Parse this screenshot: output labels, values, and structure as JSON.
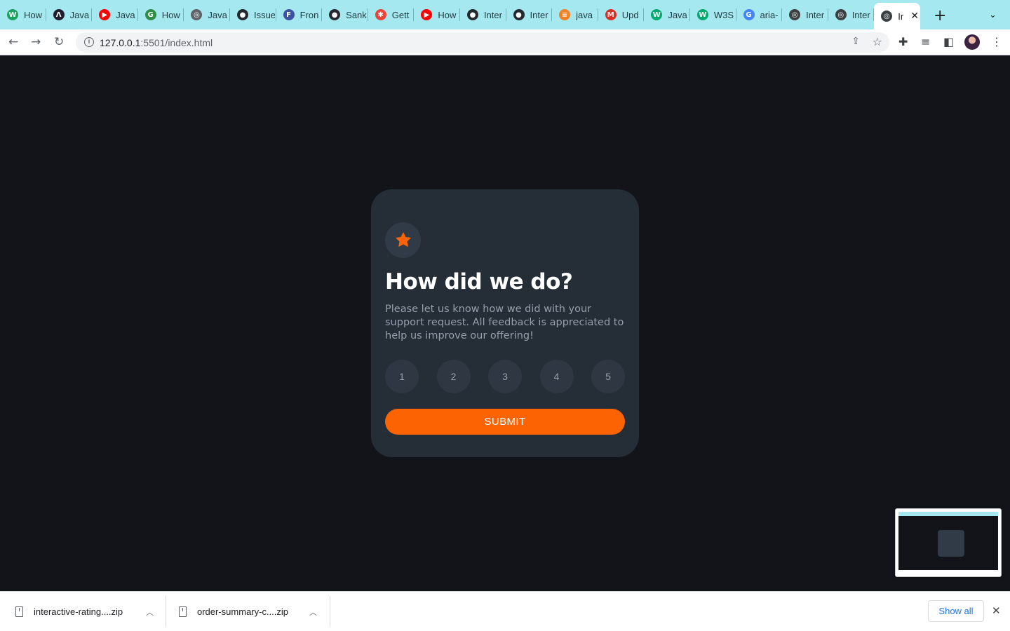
{
  "tabs": [
    {
      "title": "How",
      "icon": "wikihow-icon",
      "color": "#1aa260",
      "glyph": "W"
    },
    {
      "title": "Java",
      "icon": "app-icon",
      "color": "#1e1e2e",
      "glyph": "Λ"
    },
    {
      "title": "Java",
      "icon": "youtube-icon",
      "color": "#ff0000",
      "glyph": "▶"
    },
    {
      "title": "How",
      "icon": "geeksforgeeks-icon",
      "color": "#2f8d46",
      "glyph": "G"
    },
    {
      "title": "Java",
      "icon": "globe-icon",
      "color": "#5f6368",
      "glyph": "◎"
    },
    {
      "title": "Issue",
      "icon": "github-icon",
      "color": "#24292f",
      "glyph": "●"
    },
    {
      "title": "Fron",
      "icon": "frontend-mentor-icon",
      "color": "#3e54a3",
      "glyph": "F"
    },
    {
      "title": "Sank",
      "icon": "github-icon",
      "color": "#24292f",
      "glyph": "●"
    },
    {
      "title": "Gett",
      "icon": "asterisk-icon",
      "color": "#e8453c",
      "glyph": "✱"
    },
    {
      "title": "How",
      "icon": "youtube-icon",
      "color": "#ff0000",
      "glyph": "▶"
    },
    {
      "title": "Inter",
      "icon": "github-icon",
      "color": "#24292f",
      "glyph": "●"
    },
    {
      "title": "Inter",
      "icon": "github-icon",
      "color": "#24292f",
      "glyph": "●"
    },
    {
      "title": "java",
      "icon": "stackoverflow-icon",
      "color": "#f48024",
      "glyph": "≡"
    },
    {
      "title": "Upd",
      "icon": "gmail-icon",
      "color": "#d93025",
      "glyph": "M"
    },
    {
      "title": "Java",
      "icon": "w3schools-icon",
      "color": "#04aa6d",
      "glyph": "W"
    },
    {
      "title": "W3S",
      "icon": "w3schools-icon",
      "color": "#04aa6d",
      "glyph": "W"
    },
    {
      "title": "aria-",
      "icon": "google-icon",
      "color": "#4285f4",
      "glyph": "G"
    },
    {
      "title": "Inter",
      "icon": "globe-icon",
      "color": "#3c4043",
      "glyph": "◎"
    },
    {
      "title": "Inter",
      "icon": "globe-icon",
      "color": "#3c4043",
      "glyph": "◎"
    }
  ],
  "active_tab": {
    "title": "Ir",
    "icon": "globe-icon",
    "color": "#3c4043",
    "glyph": "◎"
  },
  "toolbar": {
    "url_host": "127.0.0.1",
    "url_rest": ":5501/index.html"
  },
  "card": {
    "title": "How did we do?",
    "description": "Please let us know how we did with your support request. All feedback is appreciated to help us improve our offering!",
    "ratings": [
      "1",
      "2",
      "3",
      "4",
      "5"
    ],
    "submit_label": "SUBMIT",
    "accent_color": "#fc6303"
  },
  "downloads": [
    {
      "name": "interactive-rating....zip"
    },
    {
      "name": "order-summary-c....zip"
    }
  ],
  "download_bar": {
    "show_all_label": "Show all"
  }
}
